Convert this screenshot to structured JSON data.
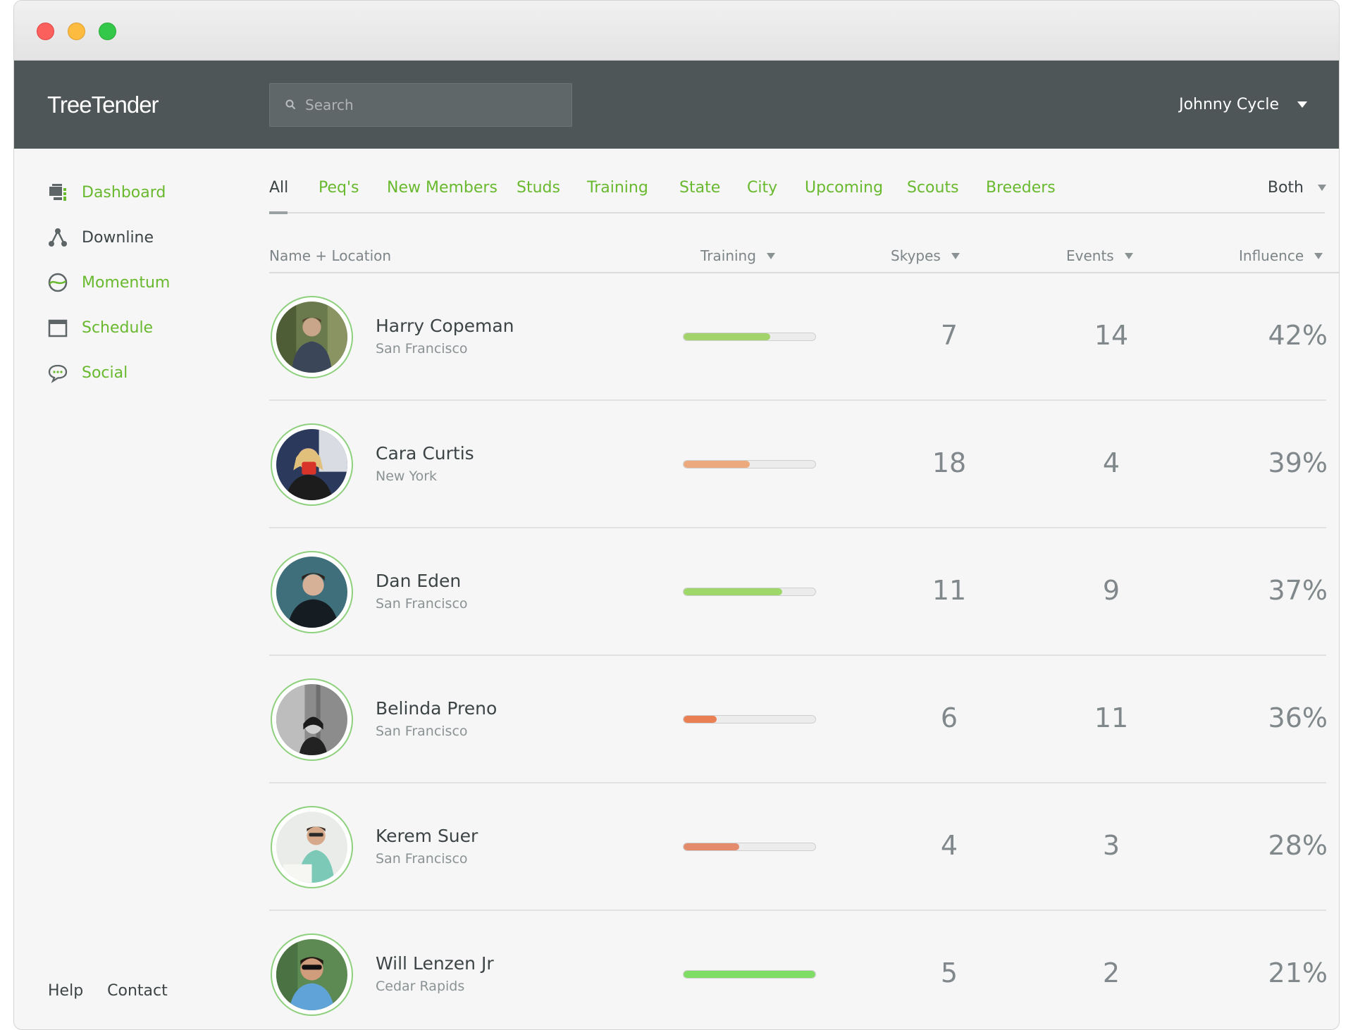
{
  "header": {
    "brand": "TreeTender",
    "search_placeholder": "Search",
    "user_name": "Johnny Cycle"
  },
  "sidebar": {
    "items": [
      {
        "label": "Dashboard",
        "icon": "dashboard-icon"
      },
      {
        "label": "Downline",
        "icon": "downline-icon"
      },
      {
        "label": "Momentum",
        "icon": "momentum-icon"
      },
      {
        "label": "Schedule",
        "icon": "schedule-icon"
      },
      {
        "label": "Social",
        "icon": "speech-bubble-icon"
      }
    ],
    "active": "Downline",
    "footer": {
      "help": "Help",
      "contact": "Contact"
    }
  },
  "tabs": [
    "All",
    "Peq's",
    "New Members",
    "Studs",
    "Training",
    "State",
    "City",
    "Upcoming",
    "Scouts",
    "Breeders"
  ],
  "active_tab": "All",
  "filter": {
    "selected": "Both"
  },
  "table": {
    "columns": {
      "name": "Name + Location",
      "training": "Training",
      "skypes": "Skypes",
      "events": "Events",
      "influence": "Influence"
    },
    "rows": [
      {
        "name": "Harry Copeman",
        "location": "San Francisco",
        "training_progress": 0.66,
        "training_color": "#a3d46c",
        "skypes": "7",
        "events": "14",
        "influence": "42%"
      },
      {
        "name": "Cara Curtis",
        "location": "New York",
        "training_progress": 0.5,
        "training_color": "#eda97e",
        "skypes": "18",
        "events": "4",
        "influence": "39%"
      },
      {
        "name": "Dan Eden",
        "location": "San Francisco",
        "training_progress": 0.75,
        "training_color": "#9ed86a",
        "skypes": "11",
        "events": "9",
        "influence": "37%"
      },
      {
        "name": "Belinda Preno",
        "location": "San Francisco",
        "training_progress": 0.25,
        "training_color": "#ea7f54",
        "skypes": "6",
        "events": "11",
        "influence": "36%"
      },
      {
        "name": "Kerem Suer",
        "location": "San Francisco",
        "training_progress": 0.42,
        "training_color": "#e38b6c",
        "skypes": "4",
        "events": "3",
        "influence": "28%"
      },
      {
        "name": "Will Lenzen Jr",
        "location": "Cedar Rapids",
        "training_progress": 1.0,
        "training_color": "#7fdc64",
        "skypes": "5",
        "events": "2",
        "influence": "21%"
      }
    ]
  }
}
